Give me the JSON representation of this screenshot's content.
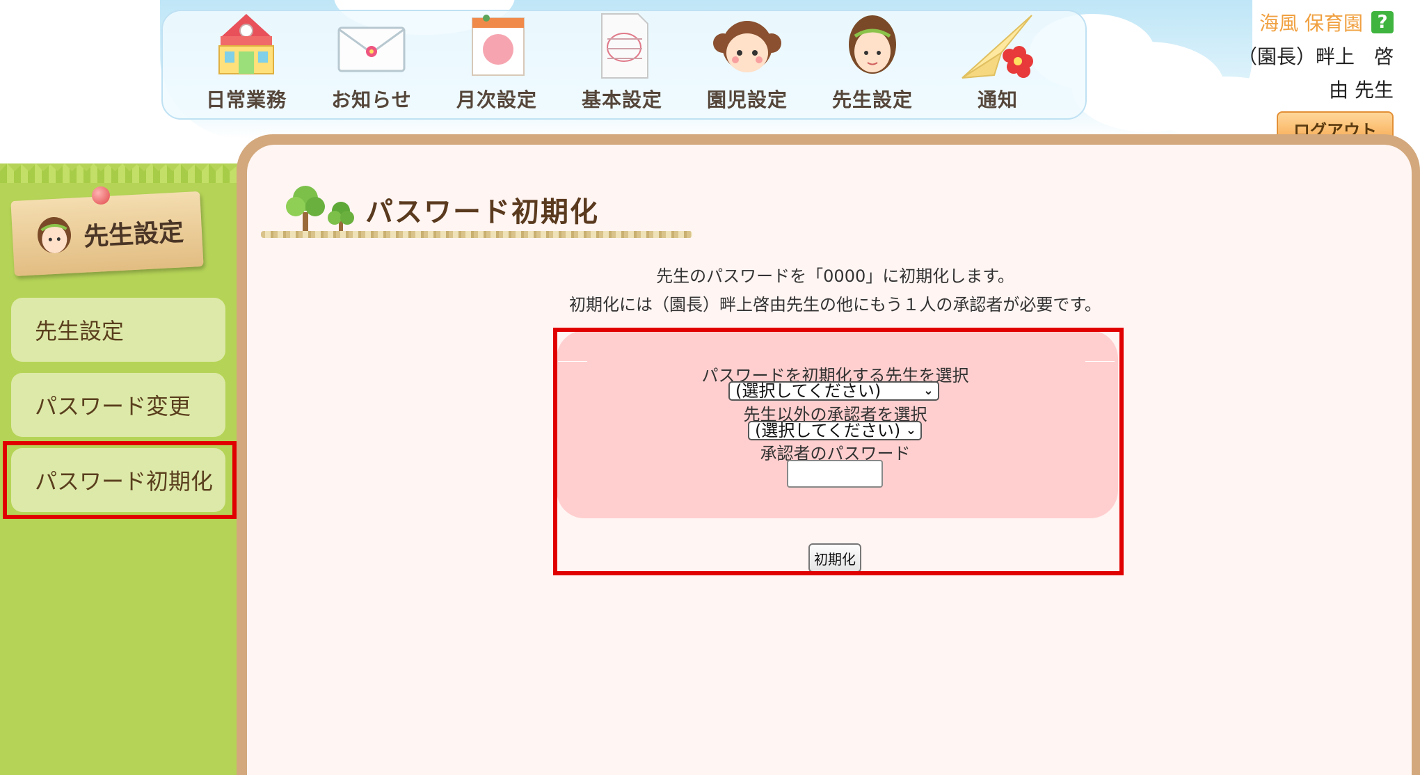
{
  "header": {
    "nav_items": [
      {
        "label": "日常業務",
        "icon": "school-building-icon"
      },
      {
        "label": "お知らせ",
        "icon": "envelope-icon"
      },
      {
        "label": "月次設定",
        "icon": "calendar-icon"
      },
      {
        "label": "基本設定",
        "icon": "document-icon"
      },
      {
        "label": "園児設定",
        "icon": "child-face-icon"
      },
      {
        "label": "先生設定",
        "icon": "teacher-face-icon"
      },
      {
        "label": "通知",
        "icon": "paper-plane-icon"
      }
    ]
  },
  "user": {
    "school_name": "海風 保育園",
    "help_label": "?",
    "role_name_line": "（園長）畔上　啓",
    "name_suffix_line": "由 先生",
    "logout_label": "ログアウト"
  },
  "sidebar": {
    "section_title": "先生設定",
    "items": [
      {
        "label": "先生設定"
      },
      {
        "label": "パスワード変更"
      },
      {
        "label": "パスワード初期化",
        "active": true
      }
    ]
  },
  "main": {
    "page_title": "パスワード初期化",
    "description_1": "先生のパスワードを「0000」に初期化します。",
    "description_2": "初期化には（園長）畔上啓由先生の他にもう１人の承認者が必要です。",
    "form": {
      "teacher_select_label": "パスワードを初期化する先生を選択",
      "teacher_select_value": "(選択してください)",
      "approver_select_label": "先生以外の承認者を選択",
      "approver_select_value": "(選択してください)",
      "approver_password_label": "承認者のパスワード",
      "approver_password_value": "",
      "submit_label": "初期化"
    }
  },
  "colors": {
    "highlight": "#e00000",
    "sidebar_green": "#b5d457",
    "menu_item": "#dde9a8",
    "form_pink": "#ffcfcf",
    "frame_brown": "#d3a87c"
  }
}
